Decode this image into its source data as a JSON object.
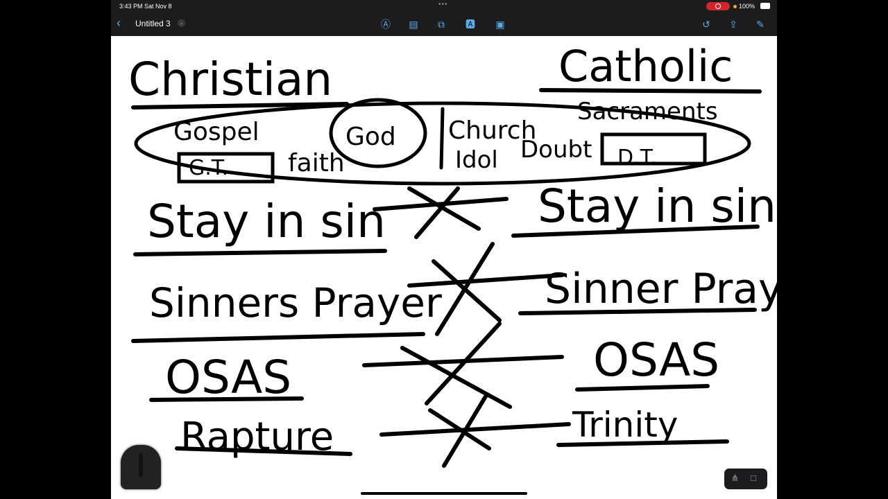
{
  "status": {
    "time": "3:43 PM  Sat Nov 8",
    "battery": "100%"
  },
  "toolbar": {
    "back": "‹",
    "title": "Untitled 3",
    "title_chevron": "⌄"
  },
  "icons": {
    "pen": "Ⓐ",
    "notes": "▤",
    "shapes": "⧉",
    "text": "🅰",
    "media": "▣",
    "undo": "↺",
    "share": "⇪",
    "compose": "✎",
    "connect": "⋔",
    "select": "□"
  },
  "canvas": {
    "left_heading": "Christian",
    "right_heading": "Catholic",
    "gospel": "Gospel",
    "god": "God",
    "faith": "faith",
    "gt": "G.T.",
    "church": "Church",
    "idol": "Idol",
    "doubt": "Doubt",
    "sacraments": "Sacraments",
    "dt": "D.T.",
    "left_items": [
      "Stay in sin",
      "Sinners Prayer",
      "OSAS",
      "Rapture"
    ],
    "right_items": [
      "Stay in sin",
      "Sinner Prayer",
      "OSAS",
      "Trinity"
    ]
  }
}
